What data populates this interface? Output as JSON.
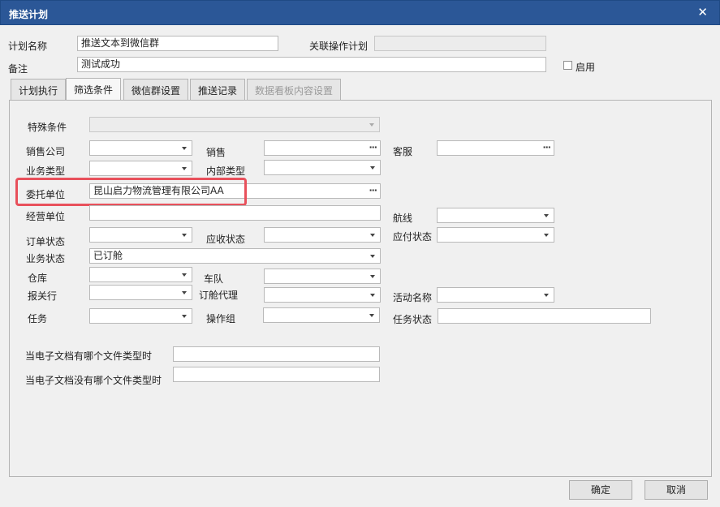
{
  "window": {
    "title": "推送计划",
    "close": "✕"
  },
  "header": {
    "plan_name_label": "计划名称",
    "plan_name_value": "推送文本到微信群",
    "related_plan_label": "关联操作计划",
    "related_plan_value": "",
    "remark_label": "备注",
    "remark_value": "测试成功",
    "enable_label": "启用",
    "enable_checked": false
  },
  "tabs": [
    {
      "label": "计划执行"
    },
    {
      "label": "筛选条件"
    },
    {
      "label": "微信群设置"
    },
    {
      "label": "推送记录"
    },
    {
      "label": "数据看板内容设置"
    }
  ],
  "filters": {
    "special_condition": {
      "label": "特殊条件",
      "value": ""
    },
    "sales_company": {
      "label": "销售公司",
      "value": ""
    },
    "sales": {
      "label": "销售",
      "value": ""
    },
    "customer_service": {
      "label": "客服",
      "value": ""
    },
    "business_type": {
      "label": "业务类型",
      "value": ""
    },
    "internal_type": {
      "label": "内部类型",
      "value": ""
    },
    "client_unit": {
      "label": "委托单位",
      "value": "昆山启力物流管理有限公司AA"
    },
    "operating_unit": {
      "label": "经营单位",
      "value": ""
    },
    "route": {
      "label": "航线",
      "value": ""
    },
    "order_status": {
      "label": "订单状态",
      "value": ""
    },
    "receivable_status": {
      "label": "应收状态",
      "value": ""
    },
    "payable_status": {
      "label": "应付状态",
      "value": ""
    },
    "business_status": {
      "label": "业务状态",
      "value": "已订舱"
    },
    "warehouse": {
      "label": "仓库",
      "value": ""
    },
    "fleet": {
      "label": "车队",
      "value": ""
    },
    "customs_broker": {
      "label": "报关行",
      "value": ""
    },
    "booking_agent": {
      "label": "订舱代理",
      "value": ""
    },
    "activity_name": {
      "label": "活动名称",
      "value": ""
    },
    "task": {
      "label": "任务",
      "value": ""
    },
    "operation_group": {
      "label": "操作组",
      "value": ""
    },
    "task_status": {
      "label": "任务状态",
      "value": ""
    },
    "doc_has_type": {
      "label": "当电子文档有哪个文件类型时",
      "value": ""
    },
    "doc_no_type": {
      "label": "当电子文档没有哪个文件类型时",
      "value": ""
    }
  },
  "buttons": {
    "ok": "确定",
    "cancel": "取消"
  },
  "colors": {
    "titlebar": "#2b5797",
    "highlight": "#e8505b"
  }
}
